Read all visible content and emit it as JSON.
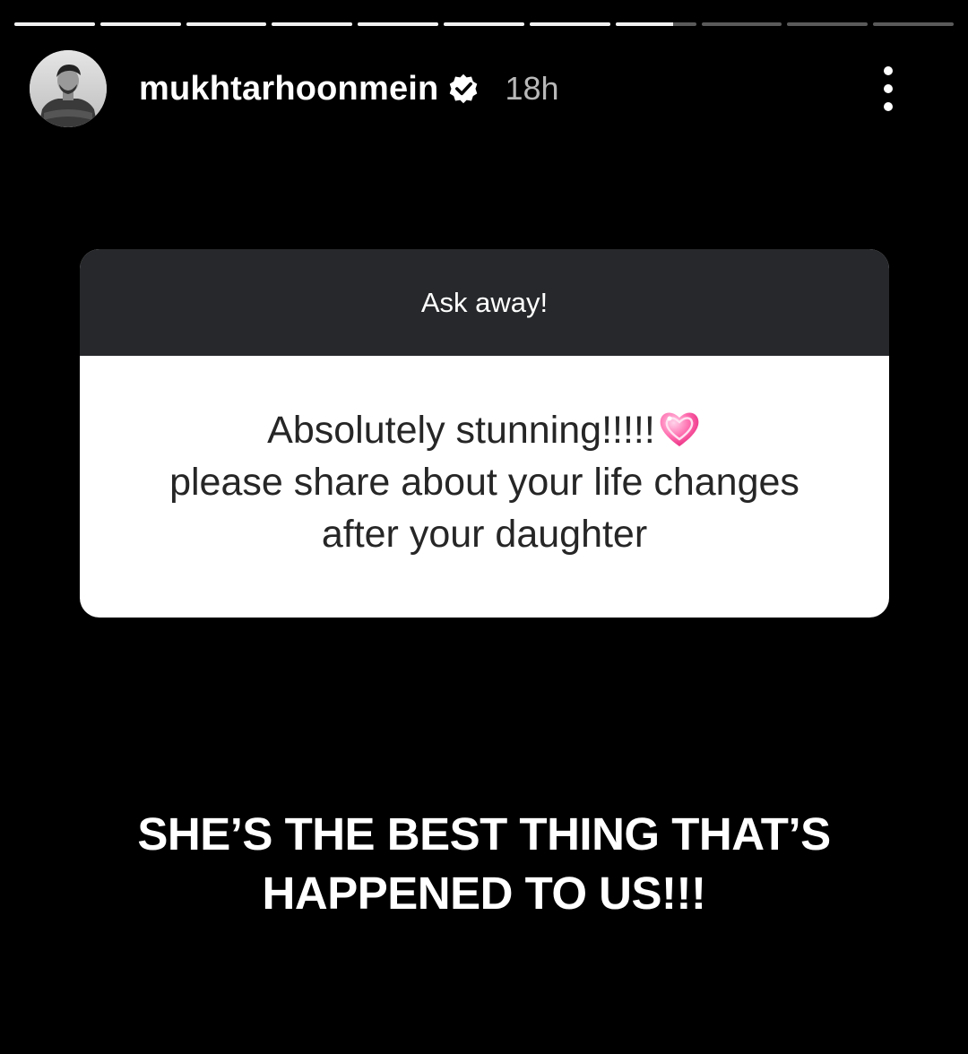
{
  "story": {
    "segments": [
      {
        "progress": 1.0
      },
      {
        "progress": 1.0
      },
      {
        "progress": 1.0
      },
      {
        "progress": 1.0
      },
      {
        "progress": 1.0
      },
      {
        "progress": 1.0
      },
      {
        "progress": 1.0
      },
      {
        "progress": 0.72
      },
      {
        "progress": 0.0
      },
      {
        "progress": 0.0
      },
      {
        "progress": 0.0
      }
    ]
  },
  "header": {
    "username": "mukhtarhoonmein",
    "verified_icon": "verified-badge-icon",
    "time": "18h",
    "more_icon": "more-vertical-icon"
  },
  "question": {
    "prompt": "Ask away!",
    "line1": "Absolutely stunning!!!!!",
    "line2": "please share about your life changes",
    "line3": "after your daughter",
    "emoji": "sparkling-heart-icon"
  },
  "answer": {
    "line1": "SHE’S THE BEST THING THAT’S",
    "line2": "HAPPENED TO US!!!"
  },
  "colors": {
    "background": "#000000",
    "card_header": "#26282b",
    "card_body": "#ffffff",
    "heart": "#ff4f9a"
  }
}
